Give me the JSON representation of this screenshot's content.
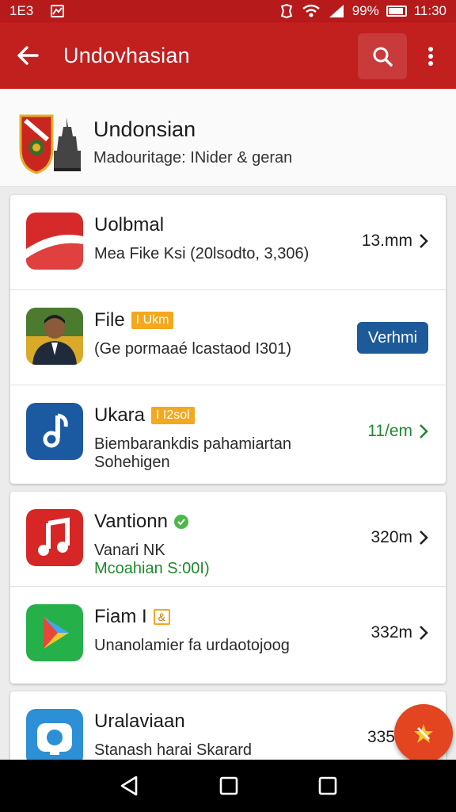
{
  "status_bar": {
    "left_text": "1E3",
    "battery_text": "99%",
    "time": "11:30"
  },
  "app_bar": {
    "title": "Undovhasian",
    "icons": [
      "back-arrow-icon",
      "search-icon",
      "more-vert-icon"
    ]
  },
  "header": {
    "title": "Undonsian",
    "subtitle": "Madouritage: INider & geran"
  },
  "cards": [
    {
      "rows": [
        {
          "title": "Uolbmal",
          "subtitle": "Mea Fike Ksi (20lsodto, 3,306)",
          "meta": "13.mm",
          "icon": "flag-app-icon"
        },
        {
          "title": "File",
          "tag": "I Ukm",
          "subtitle": "(Ge pormaaé lcastaod I301)",
          "button": "Verhmi",
          "icon": "avatar-person-icon"
        },
        {
          "title": "Ukara",
          "tag": "I I2sol",
          "subtitle": "Biembarankdis pahamiartan",
          "subtitle2": "Sohehigen",
          "meta": "11/em",
          "icon": "music-app-icon"
        }
      ]
    },
    {
      "rows": [
        {
          "title": "Vantionn",
          "subtitle": "Vanari NK",
          "subtitle2": "Mcoahian S:00I)",
          "meta": "320m",
          "icon": "music-red-icon"
        },
        {
          "title": "Fiam I",
          "tag": "&",
          "subtitle": "Unanolamier fa urdaotojoog",
          "meta": "332m",
          "icon": "play-store-icon"
        }
      ]
    },
    {
      "rows": [
        {
          "title": "Uralaviaan",
          "subtitle": "Stanash harai Skarard",
          "meta": "335",
          "icon": "camera-app-icon"
        }
      ]
    }
  ],
  "colors": {
    "status_bar": "#b61a1a",
    "app_bar": "#c21f1f",
    "accent_orange": "#f3a81d",
    "button_blue": "#1d5a99",
    "green_text": "#1d8a2d",
    "fab": "#e2451f"
  }
}
